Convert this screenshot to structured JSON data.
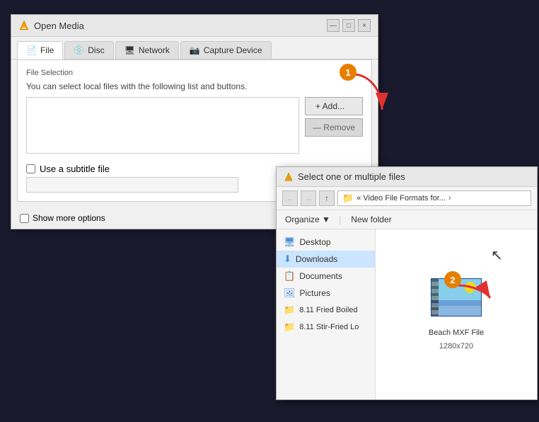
{
  "openMediaWindow": {
    "title": "Open Media",
    "tabs": [
      {
        "id": "file",
        "label": "File",
        "active": true,
        "icon": "📄"
      },
      {
        "id": "disc",
        "label": "Disc",
        "active": false,
        "icon": "💿"
      },
      {
        "id": "network",
        "label": "Network",
        "active": false,
        "icon": "🖥"
      },
      {
        "id": "capture",
        "label": "Capture Device",
        "active": false,
        "icon": "📷"
      }
    ],
    "fileSection": {
      "label": "File Selection",
      "desc": "You can select local files with the following list and buttons.",
      "addButton": "+ Add...",
      "removeButton": "— Remove",
      "subtitleCheckbox": "Use a subtitle file"
    },
    "bottomBar": {
      "showMore": "Show more options"
    }
  },
  "fileDialog": {
    "title": "Select one or multiple files",
    "pathText": "« Video File Formats for...",
    "toolbar": {
      "organize": "Organize ▼",
      "newFolder": "New folder"
    },
    "sidebarItems": [
      {
        "id": "desktop",
        "label": "Desktop",
        "icon": "🖥",
        "type": "desktop"
      },
      {
        "id": "downloads",
        "label": "Downloads",
        "icon": "⬇",
        "type": "downloads"
      },
      {
        "id": "documents",
        "label": "Documents",
        "icon": "📋",
        "type": "documents"
      },
      {
        "id": "pictures",
        "label": "Pictures",
        "icon": "🖼",
        "type": "pictures"
      },
      {
        "id": "folder1",
        "label": "8.11 Fried Boiled",
        "icon": "📁",
        "type": "folder"
      },
      {
        "id": "folder2",
        "label": "8.11 Stir-Fried Lo",
        "icon": "📁",
        "type": "folder"
      }
    ],
    "preview": {
      "fileName": "Beach MXF File",
      "fileMeta": "1280x720"
    }
  },
  "annotations": {
    "badge1": "1",
    "badge2": "2"
  },
  "titleControls": {
    "minimize": "—",
    "maximize": "□",
    "close": "×"
  }
}
